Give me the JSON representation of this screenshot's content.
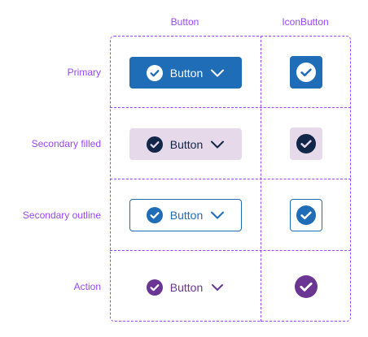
{
  "columns": {
    "button": "Button",
    "icon_button": "IconButton"
  },
  "rows": [
    {
      "label": "Primary",
      "button_label": "Button"
    },
    {
      "label": "Secondary filled",
      "button_label": "Button"
    },
    {
      "label": "Secondary outline",
      "button_label": "Button"
    },
    {
      "label": "Action",
      "button_label": "Button"
    }
  ],
  "icons": {
    "leading": "check-circle-icon",
    "trailing": "chevron-down-icon"
  },
  "colors": {
    "annotation": "#9747ff",
    "primary": "#1f6cb7",
    "secondary_filled_bg": "#e6d9ea",
    "secondary_filled_fg": "#112649",
    "action": "#6b3593"
  }
}
